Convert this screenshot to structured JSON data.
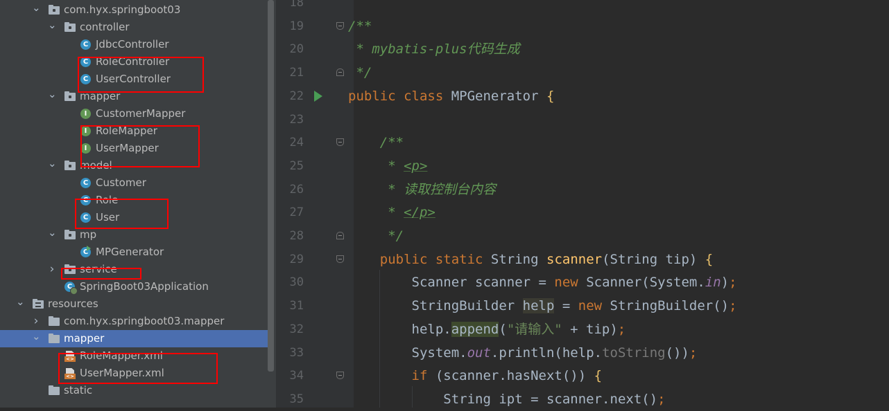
{
  "tree": [
    {
      "label": "com.hyx.springboot03",
      "icon": "package-folder-icon",
      "arrow": "expanded",
      "indent": 0,
      "row": 0
    },
    {
      "label": "controller",
      "icon": "package-folder-icon",
      "arrow": "expanded",
      "indent": 1,
      "row": 1
    },
    {
      "label": "JdbcController",
      "icon": "class-icon",
      "arrow": "none",
      "indent": 2,
      "row": 2
    },
    {
      "label": "RoleController",
      "icon": "class-icon",
      "arrow": "none",
      "indent": 2,
      "row": 3
    },
    {
      "label": "UserController",
      "icon": "class-icon",
      "arrow": "none",
      "indent": 2,
      "row": 4
    },
    {
      "label": "mapper",
      "icon": "package-folder-icon",
      "arrow": "expanded",
      "indent": 1,
      "row": 5
    },
    {
      "label": "CustomerMapper",
      "icon": "interface-icon",
      "arrow": "none",
      "indent": 2,
      "row": 6
    },
    {
      "label": "RoleMapper",
      "icon": "interface-icon",
      "arrow": "none",
      "indent": 2,
      "row": 7
    },
    {
      "label": "UserMapper",
      "icon": "interface-icon",
      "arrow": "none",
      "indent": 2,
      "row": 8
    },
    {
      "label": "model",
      "icon": "package-folder-icon",
      "arrow": "expanded",
      "indent": 1,
      "row": 9
    },
    {
      "label": "Customer",
      "icon": "class-icon",
      "arrow": "none",
      "indent": 2,
      "row": 10
    },
    {
      "label": "Role",
      "icon": "class-icon",
      "arrow": "none",
      "indent": 2,
      "row": 11
    },
    {
      "label": "User",
      "icon": "class-icon",
      "arrow": "none",
      "indent": 2,
      "row": 12
    },
    {
      "label": "mp",
      "icon": "package-folder-icon",
      "arrow": "expanded",
      "indent": 1,
      "row": 13
    },
    {
      "label": "MPGenerator",
      "icon": "runnable-class-icon",
      "arrow": "none",
      "indent": 2,
      "row": 14
    },
    {
      "label": "service",
      "icon": "package-folder-icon",
      "arrow": "collapsed",
      "indent": 1,
      "row": 15
    },
    {
      "label": "SpringBoot03Application",
      "icon": "spring-boot-class-icon",
      "arrow": "none",
      "indent": 1,
      "row": 16
    },
    {
      "label": "resources",
      "icon": "resources-folder-icon",
      "arrow": "expanded",
      "indent": -1,
      "row": 17
    },
    {
      "label": "com.hyx.springboot03.mapper",
      "icon": "folder-icon",
      "arrow": "collapsed",
      "indent": 0,
      "row": 18
    },
    {
      "label": "mapper",
      "icon": "folder-icon",
      "arrow": "expanded",
      "indent": 0,
      "row": 19,
      "selected": true
    },
    {
      "label": "RoleMapper.xml",
      "icon": "xml-file-icon",
      "arrow": "none",
      "indent": 1,
      "row": 20
    },
    {
      "label": "UserMapper.xml",
      "icon": "xml-file-icon",
      "arrow": "none",
      "indent": 1,
      "row": 21
    },
    {
      "label": "static",
      "icon": "folder-icon",
      "arrow": "none",
      "indent": 0,
      "row": 22
    }
  ],
  "highlight_color": "#ff0000",
  "run_icon": "run-gutter-icon",
  "code_lines": [
    {
      "n": "18",
      "html": ""
    },
    {
      "n": "19",
      "html": "<span class=\"doc\">/**</span>",
      "fold": "start"
    },
    {
      "n": "20",
      "html": "<span class=\"doc\"> * mybatis-plus代码生成</span>"
    },
    {
      "n": "21",
      "html": "<span class=\"doc\"> */</span>",
      "fold": "end"
    },
    {
      "n": "22",
      "html": "<span class=\"kw\">public class </span>MPGenerator <span class=\"br\">{</span>",
      "run": true
    },
    {
      "n": "23",
      "html": ""
    },
    {
      "n": "24",
      "html": "    <span class=\"doc\">/**</span>",
      "fold": "start"
    },
    {
      "n": "25",
      "html": "<span class=\"doc\">     * </span><span class=\"tag\">&lt;p&gt;</span>"
    },
    {
      "n": "26",
      "html": "<span class=\"doc\">     * 读取控制台内容</span>"
    },
    {
      "n": "27",
      "html": "<span class=\"doc\">     * </span><span class=\"tag\">&lt;/p&gt;</span>"
    },
    {
      "n": "28",
      "html": "<span class=\"doc\">     */</span>",
      "fold": "end"
    },
    {
      "n": "29",
      "html": "    <span class=\"kw\">public static </span>String <span class=\"fn\">scanner</span>(String tip) <span class=\"br\">{</span>",
      "fold": "start"
    },
    {
      "n": "30",
      "html": "        Scanner scanner = <span class=\"kw\">new </span>Scanner(System.<span class=\"fld\">in</span>)<span class=\"kw\">;</span>"
    },
    {
      "n": "31",
      "html": "        StringBuilder <span class=\"vhl\">help</span> = <span class=\"kw\">new </span>StringBuilder()<span class=\"kw\">;</span>"
    },
    {
      "n": "32",
      "html": "        help.<span class=\"ahl\">append</span>(<span class=\"str\">\"请输入\"</span> + tip)<span class=\"kw\">;</span>"
    },
    {
      "n": "33",
      "html": "        System.<span class=\"fld\">out</span>.println(help.<span class=\"dim\">toString</span>())<span class=\"kw\">;</span>"
    },
    {
      "n": "34",
      "html": "        <span class=\"kw\">if </span>(scanner.hasNext()) <span class=\"br\">{</span>",
      "fold": "start"
    },
    {
      "n": "35",
      "html": "            <span class=\"kw\"></span>String ipt = scanner.next()<span class=\"kw\">;</span>"
    }
  ]
}
